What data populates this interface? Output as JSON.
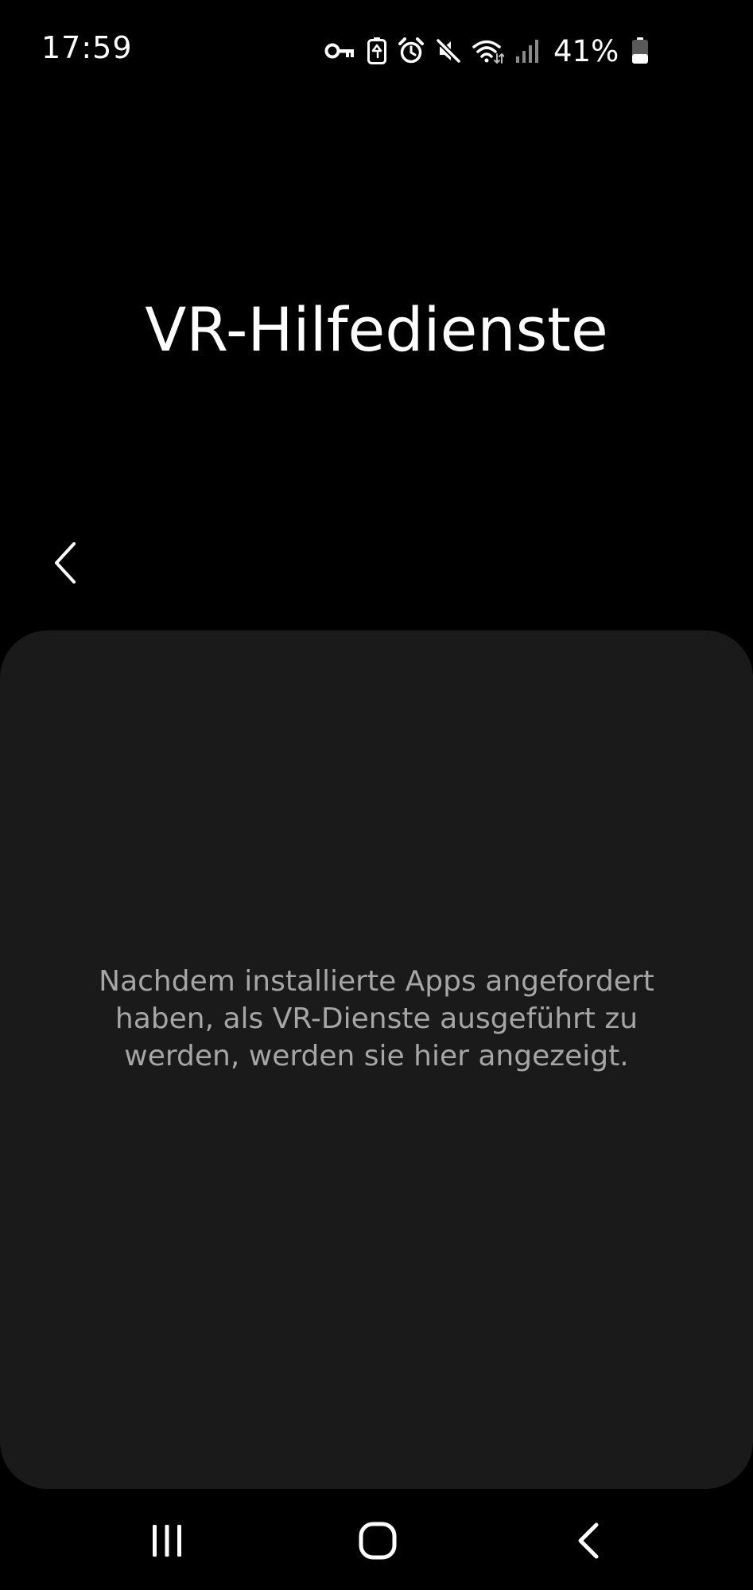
{
  "status_bar": {
    "time": "17:59",
    "battery_percent": "41%",
    "battery_level": 0.41,
    "icons": [
      "vpn-key-icon",
      "battery-saver-icon",
      "alarm-icon",
      "mute-icon",
      "wifi-icon",
      "signal-icon",
      "battery-icon"
    ]
  },
  "header": {
    "title": "VR-Hilfedienste",
    "back_icon": "chevron-left-icon"
  },
  "content": {
    "empty_message": "Nachdem installierte Apps angefordert haben, als VR-Dienste ausgeführt zu werden, werden sie hier angezeigt."
  },
  "navigation_bar": {
    "buttons": [
      "recents-icon",
      "home-icon",
      "back-icon"
    ]
  },
  "colors": {
    "background": "#000000",
    "card": "#1a1a1a",
    "primary_text": "#ffffff",
    "secondary_text": "#a6a6a6"
  }
}
